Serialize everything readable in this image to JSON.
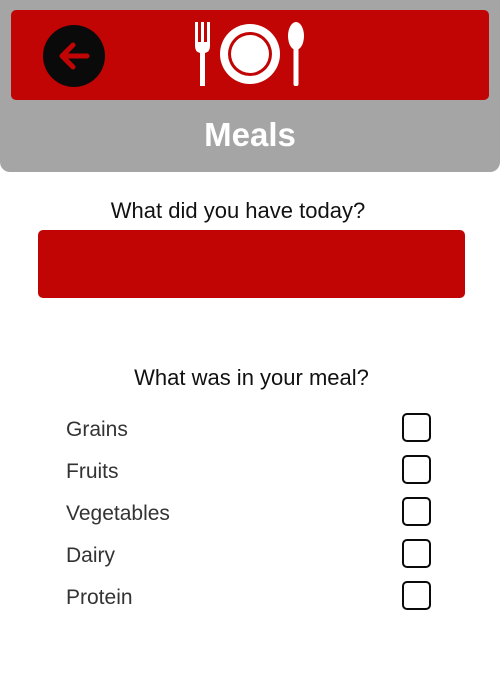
{
  "header": {
    "title": "Meals",
    "back_icon": "arrow-left-icon",
    "logo_icon": "fork-plate-spoon-icon"
  },
  "meal": {
    "question": "What did you have today?",
    "value": "",
    "placeholder": ""
  },
  "ingredients": {
    "question": "What was in your meal?",
    "items": [
      {
        "label": "Grains",
        "checked": false
      },
      {
        "label": "Fruits",
        "checked": false
      },
      {
        "label": "Vegetables",
        "checked": false
      },
      {
        "label": "Dairy",
        "checked": false
      },
      {
        "label": "Protein",
        "checked": false
      }
    ]
  },
  "colors": {
    "accent_red": "#c10404",
    "header_gray": "#a5a5a5",
    "dark": "#0a0a0a",
    "white": "#ffffff"
  }
}
